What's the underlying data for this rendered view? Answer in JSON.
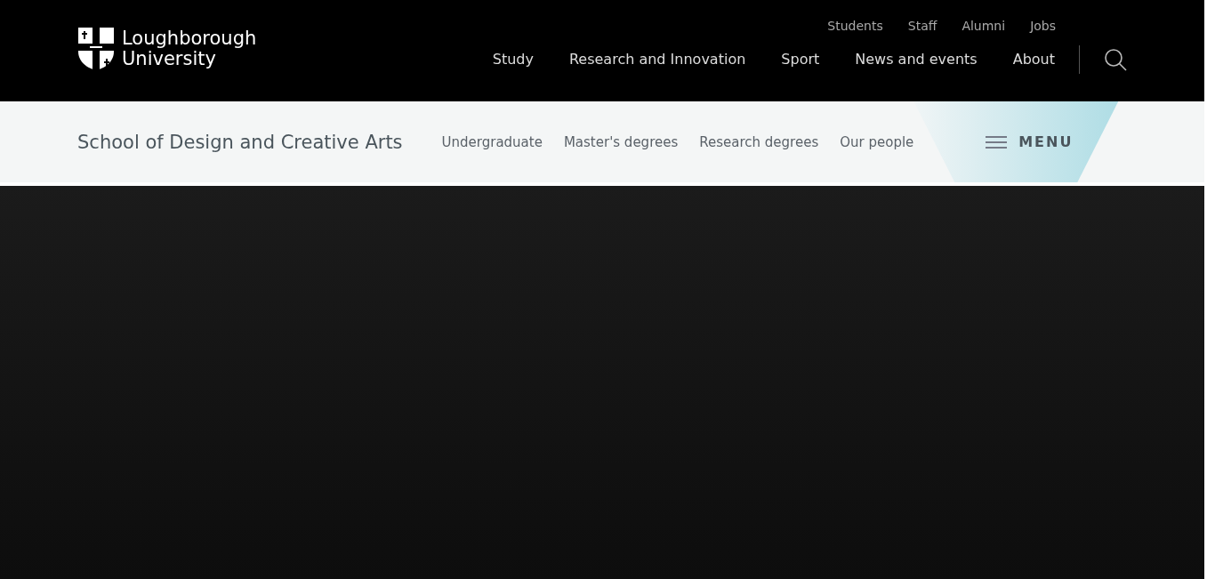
{
  "header": {
    "logo": {
      "line_1": "Loughborough",
      "line_2": "University"
    },
    "utility_links": [
      "Students",
      "Staff",
      "Alumni",
      "Jobs"
    ],
    "main_nav": [
      "Study",
      "Research and Innovation",
      "Sport",
      "News and events",
      "About"
    ]
  },
  "school_bar": {
    "title": "School of Design and Creative Arts",
    "links": [
      "Undergraduate",
      "Master's degrees",
      "Research degrees",
      "Our people"
    ],
    "menu_button": "MENU"
  }
}
